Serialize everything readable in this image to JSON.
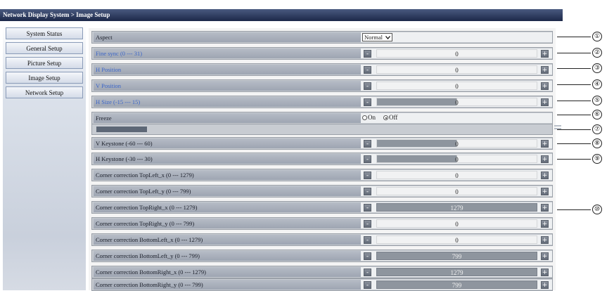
{
  "header": {
    "title": "Network Display System > Image Setup"
  },
  "sidebar": {
    "items": [
      {
        "label": "System Status"
      },
      {
        "label": "General Setup"
      },
      {
        "label": "Picture Setup"
      },
      {
        "label": "Image Setup"
      },
      {
        "label": "Network Setup"
      }
    ]
  },
  "rows": {
    "aspect": {
      "label": "Aspect",
      "value": "Normal"
    },
    "fine_sync": {
      "label": "Fine sync (0 --- 31)",
      "value": "0"
    },
    "h_position": {
      "label": "H Position",
      "value": "0"
    },
    "v_position": {
      "label": "V Position",
      "value": "0"
    },
    "h_size": {
      "label": "H Size (-15 --- 15)",
      "value": "0"
    },
    "freeze": {
      "label": "Freeze",
      "on_label": "On",
      "off_label": "Off",
      "selected": "Off"
    },
    "v_keystone": {
      "label": "V Keystone (-60 --- 60)",
      "value": "0"
    },
    "h_keystone": {
      "label": "H Keystone (-30 --- 30)",
      "value": "0"
    },
    "tl_x": {
      "label": "Corner correction TopLeft_x (0 --- 1279)",
      "value": "0"
    },
    "tl_y": {
      "label": "Corner correction TopLeft_y (0 --- 799)",
      "value": "0"
    },
    "tr_x": {
      "label": "Corner correction TopRight_x (0 --- 1279)",
      "value": "1279"
    },
    "tr_y": {
      "label": "Corner correction TopRight_y (0 --- 799)",
      "value": "0"
    },
    "bl_x": {
      "label": "Corner correction BottomLeft_x (0 --- 1279)",
      "value": "0"
    },
    "bl_y": {
      "label": "Corner correction BottomLeft_y (0 --- 799)",
      "value": "799"
    },
    "br_x": {
      "label": "Corner correction BottomRight_x (0 --- 1279)",
      "value": "1279"
    },
    "br_y": {
      "label": "Corner correction BottomRight_y (0 --- 799)",
      "value": "799"
    }
  },
  "buttons": {
    "minus": "-",
    "plus": "+"
  },
  "callouts": [
    "①",
    "②",
    "③",
    "④",
    "⑤",
    "⑥",
    "⑦",
    "⑧",
    "⑨",
    "⑩"
  ],
  "colors": {
    "header_bg": "#1c2748",
    "label_bg": "#a4abb8",
    "link_text": "#3c66c8",
    "slider_fill": "#8e959e"
  }
}
